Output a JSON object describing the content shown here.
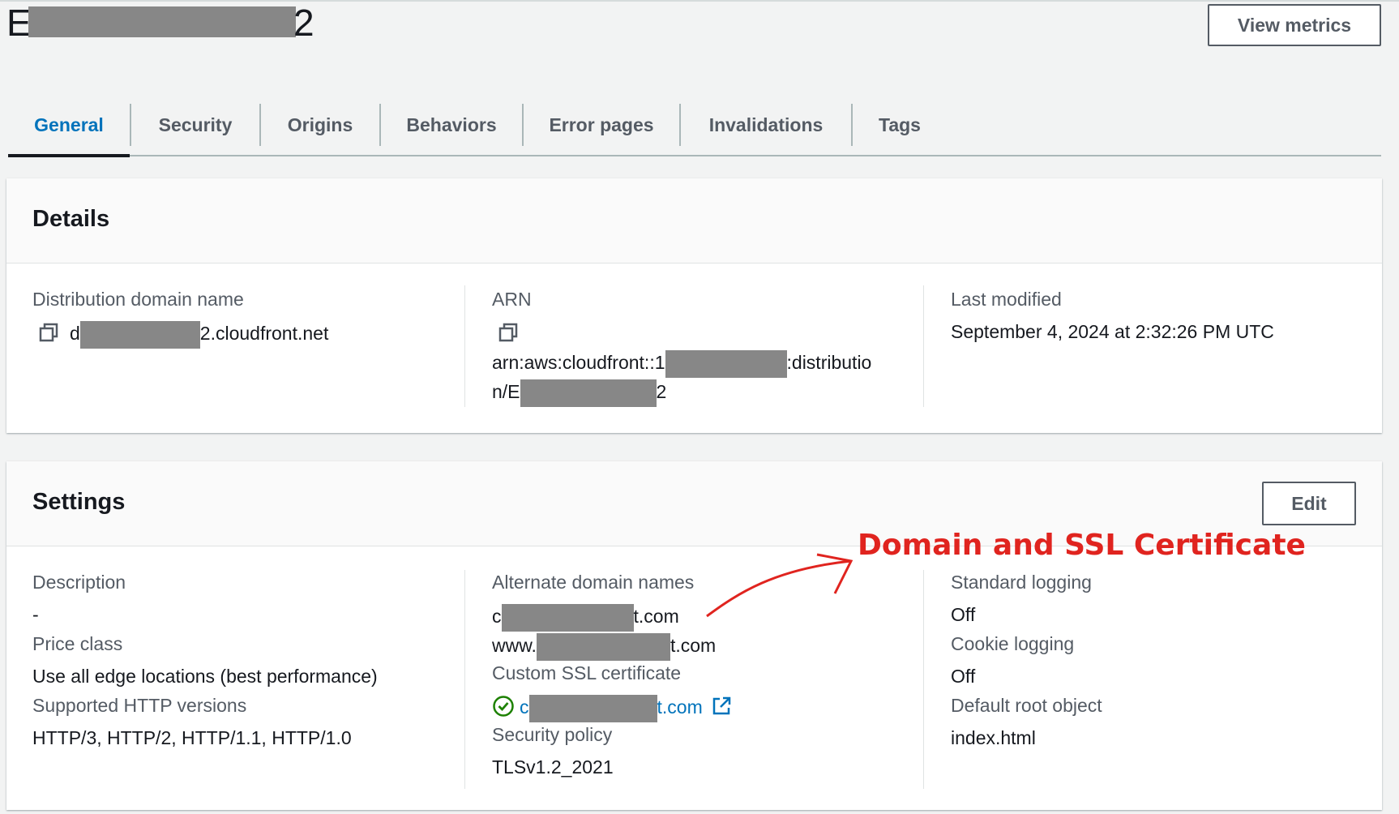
{
  "header": {
    "title_prefix": "E",
    "title_suffix": "2",
    "view_metrics_label": "View metrics"
  },
  "tabs": [
    {
      "label": "General",
      "active": true
    },
    {
      "label": "Security"
    },
    {
      "label": "Origins"
    },
    {
      "label": "Behaviors"
    },
    {
      "label": "Error pages"
    },
    {
      "label": "Invalidations"
    },
    {
      "label": "Tags"
    }
  ],
  "details": {
    "title": "Details",
    "distribution_domain": {
      "label": "Distribution domain name",
      "prefix": "d",
      "suffix": "2.cloudfront.net"
    },
    "arn": {
      "label": "ARN",
      "line1_prefix": "arn:aws:cloudfront::1",
      "line1_suffix": ":distributio",
      "line2_prefix": "n/E",
      "line2_suffix": "2"
    },
    "last_modified": {
      "label": "Last modified",
      "value": "September 4, 2024 at 2:32:26 PM UTC"
    }
  },
  "settings": {
    "title": "Settings",
    "edit_label": "Edit",
    "description": {
      "label": "Description",
      "value": "-"
    },
    "price_class": {
      "label": "Price class",
      "value": "Use all edge locations (best performance)"
    },
    "http_versions": {
      "label": "Supported HTTP versions",
      "value": "HTTP/3, HTTP/2, HTTP/1.1, HTTP/1.0"
    },
    "alternate_domains": {
      "label": "Alternate domain names",
      "item1_prefix": "c",
      "item1_suffix": "t.com",
      "item2_prefix": "www.",
      "item2_suffix": "t.com"
    },
    "ssl_certificate": {
      "label": "Custom SSL certificate",
      "prefix": "c",
      "suffix": "t.com"
    },
    "security_policy": {
      "label": "Security policy",
      "value": "TLSv1.2_2021"
    },
    "standard_logging": {
      "label": "Standard logging",
      "value": "Off"
    },
    "cookie_logging": {
      "label": "Cookie logging",
      "value": "Off"
    },
    "default_root_object": {
      "label": "Default root object",
      "value": "index.html"
    }
  },
  "annotation": {
    "text": "Domain and SSL Certificate",
    "color": "#e0241f"
  },
  "colors": {
    "link": "#0073bb",
    "success": "#1d8102",
    "background": "#f2f3f3"
  }
}
